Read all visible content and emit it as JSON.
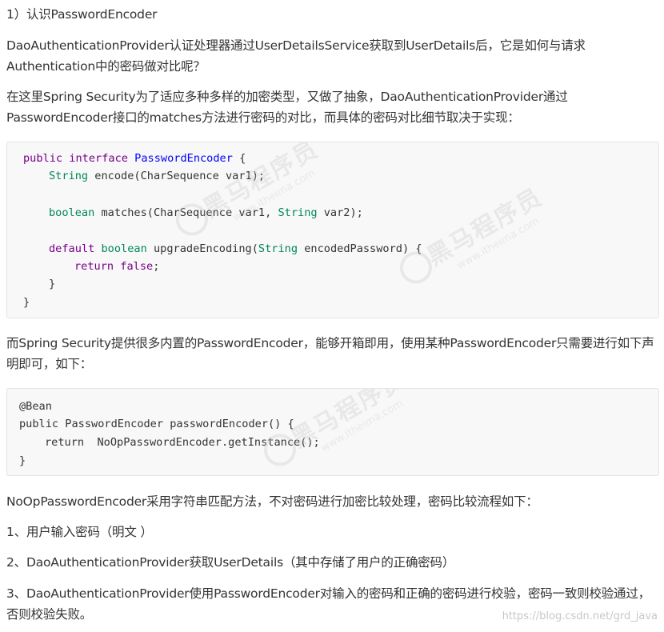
{
  "paragraphs": {
    "heading": "1）认识PasswordEncoder",
    "p1": "DaoAuthenticationProvider认证处理器通过UserDetailsService获取到UserDetails后，它是如何与请求Authentication中的密码做对比呢？",
    "p2": " 在这里Spring Security为了适应多种多样的加密类型，又做了抽象，DaoAuthenticationProvider通过PasswordEncoder接口的matches方法进行密码的对比，而具体的密码对比细节取决于实现：",
    "p3": "而Spring Security提供很多内置的PasswordEncoder，能够开箱即用，使用某种PasswordEncoder只需要进行如下声明即可，如下：",
    "p4": "NoOpPasswordEncoder采用字符串匹配方法，不对密码进行加密比较处理，密码比较流程如下：",
    "step1": "1、用户输入密码（明文 ）",
    "step2": "2、DaoAuthenticationProvider获取UserDetails（其中存储了用户的正确密码）",
    "step3": "3、DaoAuthenticationProvider使用PasswordEncoder对输入的密码和正确的密码进行校验，密码一致则校验通过，否则校验失败。"
  },
  "code1": {
    "l1_kw1": "public",
    "l1_kw2": "interface",
    "l1_name": "PasswordEncoder",
    "l1_rest": " {",
    "l2_type": "String",
    "l2_rest": " encode(CharSequence var1);",
    "l3_type": "boolean",
    "l3_mid": " matches(CharSequence var1, ",
    "l3_type2": "String",
    "l3_rest": " var2);",
    "l4_kw": "default",
    "l4_type": "boolean",
    "l4_mid": " upgradeEncoding(",
    "l4_type2": "String",
    "l4_rest": " encodedPassword) {",
    "l5_kw1": "return",
    "l5_kw2": "false",
    "l5_rest": ";",
    "l6": "}",
    "l7": "}"
  },
  "code2": {
    "l1": "@Bean",
    "l2": "public PasswordEncoder passwordEncoder() {",
    "l3": "return  NoOpPasswordEncoder.getInstance();",
    "l4": "}"
  },
  "watermark": {
    "cn": "黑马程序员",
    "en": "www.itheima.com"
  },
  "footer": {
    "url": "https://blog.csdn.net/grd_java"
  },
  "colors": {
    "keyword": "#770088",
    "type": "#008855",
    "definition": "#0000ff",
    "code_bg": "#f8f8f8"
  }
}
